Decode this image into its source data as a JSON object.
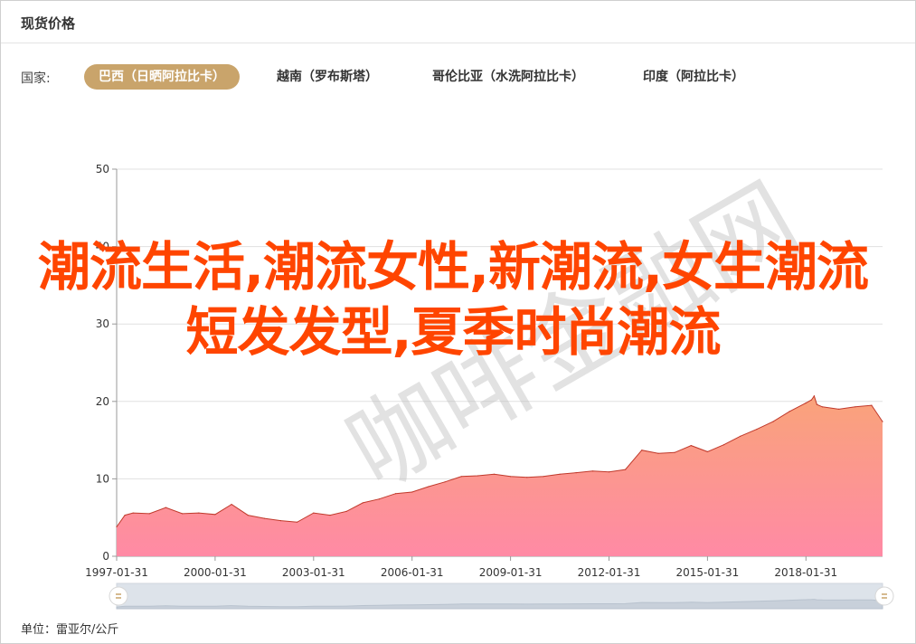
{
  "header": {
    "title": "现货价格"
  },
  "countries": {
    "label": "国家:",
    "tabs": [
      {
        "label": "巴西（日晒阿拉比卡）",
        "active": true
      },
      {
        "label": "越南（罗布斯塔）",
        "active": false
      },
      {
        "label": "哥伦比亚（水洗阿拉比卡）",
        "active": false
      },
      {
        "label": "印度（阿拉比卡）",
        "active": false
      }
    ]
  },
  "overlay_text": "潮流生活,潮流女性,新潮流,女生潮流短发发型,夏季时尚潮流",
  "watermark_text": "咖啡金融网",
  "unit": "单位：雷亚尔/公斤",
  "colors": {
    "accent": "#c9a46b",
    "area_top": "#f9a37a",
    "area_bottom": "#ff8aa5",
    "line": "#c0392b",
    "overlay": "#ff4500"
  },
  "chart_data": {
    "type": "area",
    "title": "",
    "xlabel": "",
    "ylabel": "",
    "ylim": [
      0,
      50
    ],
    "yticks": [
      0,
      10,
      20,
      30,
      40,
      50
    ],
    "xlim": [
      "1997-01-31",
      "2020-05-31"
    ],
    "xticks": [
      "1997-01-31",
      "2000-01-31",
      "2003-01-31",
      "2006-01-31",
      "2009-01-31",
      "2012-01-31",
      "2015-01-31",
      "2018-01-31"
    ],
    "grid": true,
    "x": [
      "1997-01",
      "1997-04",
      "1997-07",
      "1998-01",
      "1998-07",
      "1999-01",
      "1999-07",
      "2000-01",
      "2000-07",
      "2001-01",
      "2001-07",
      "2002-01",
      "2002-07",
      "2003-01",
      "2003-07",
      "2004-01",
      "2004-07",
      "2005-01",
      "2005-07",
      "2006-01",
      "2006-07",
      "2007-01",
      "2007-07",
      "2008-01",
      "2008-07",
      "2009-01",
      "2009-07",
      "2010-01",
      "2010-07",
      "2011-01",
      "2011-07",
      "2012-01",
      "2012-07",
      "2013-01",
      "2013-07",
      "2014-01",
      "2014-07",
      "2015-01",
      "2015-07",
      "2016-01",
      "2016-07",
      "2017-01",
      "2017-07",
      "2018-01",
      "2018-03",
      "2018-04",
      "2018-05",
      "2018-07",
      "2019-01",
      "2019-07",
      "2020-01",
      "2020-05"
    ],
    "values": [
      3.8,
      5.3,
      5.6,
      5.5,
      6.3,
      5.5,
      5.6,
      5.4,
      6.7,
      5.3,
      4.9,
      4.6,
      4.4,
      5.6,
      5.3,
      5.8,
      6.9,
      7.4,
      8.1,
      8.3,
      9.0,
      9.6,
      10.3,
      10.4,
      10.6,
      10.3,
      10.2,
      10.3,
      10.6,
      10.8,
      11.0,
      10.9,
      11.2,
      13.7,
      13.3,
      13.4,
      14.3,
      13.5,
      14.4,
      15.5,
      16.4,
      17.4,
      18.7,
      19.8,
      20.2,
      20.7,
      19.6,
      19.3,
      19.0,
      19.3,
      19.5,
      17.4
    ]
  }
}
